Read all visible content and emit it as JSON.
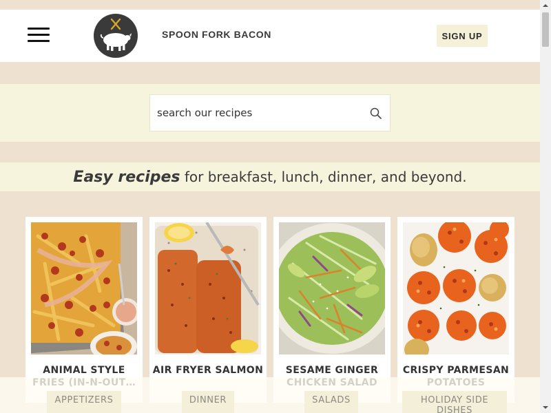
{
  "header": {
    "brand": "SPOON FORK BACON",
    "signup_label": "SIGN UP",
    "logo_icon": "pig-fork-spoon-logo-icon",
    "menu_icon": "hamburger-menu-icon"
  },
  "search": {
    "placeholder": "search our recipes",
    "value": "",
    "icon": "search-icon"
  },
  "tagline": {
    "emphasis": "Easy recipes",
    "rest": " for breakfast, lunch, dinner, and beyond."
  },
  "cards": [
    {
      "title": "ANIMAL STYLE FRIES (IN-N-OUT COPYCAT)",
      "title_visible": "ANIMAL STYLE FRIES (IN-N-OUT…",
      "category": "APPETIZERS"
    },
    {
      "title": "AIR FRYER SALMON",
      "title_visible": "AIR FRYER SALMON",
      "category": "DINNER"
    },
    {
      "title": "SESAME GINGER CHICKEN SALAD",
      "title_visible": "SESAME GINGER CHICKEN SALAD",
      "category": "SALADS"
    },
    {
      "title": "CRISPY PARMESAN POTATOES",
      "title_visible": "CRISPY PARMESAN POTATOES",
      "category": "HOLIDAY SIDE DISHES"
    }
  ],
  "colors": {
    "page_bg": "#efe1cf",
    "band_bg": "#f6f4dc",
    "button_bg": "#f5f1d9",
    "logo_bg": "#3a3a3a"
  }
}
